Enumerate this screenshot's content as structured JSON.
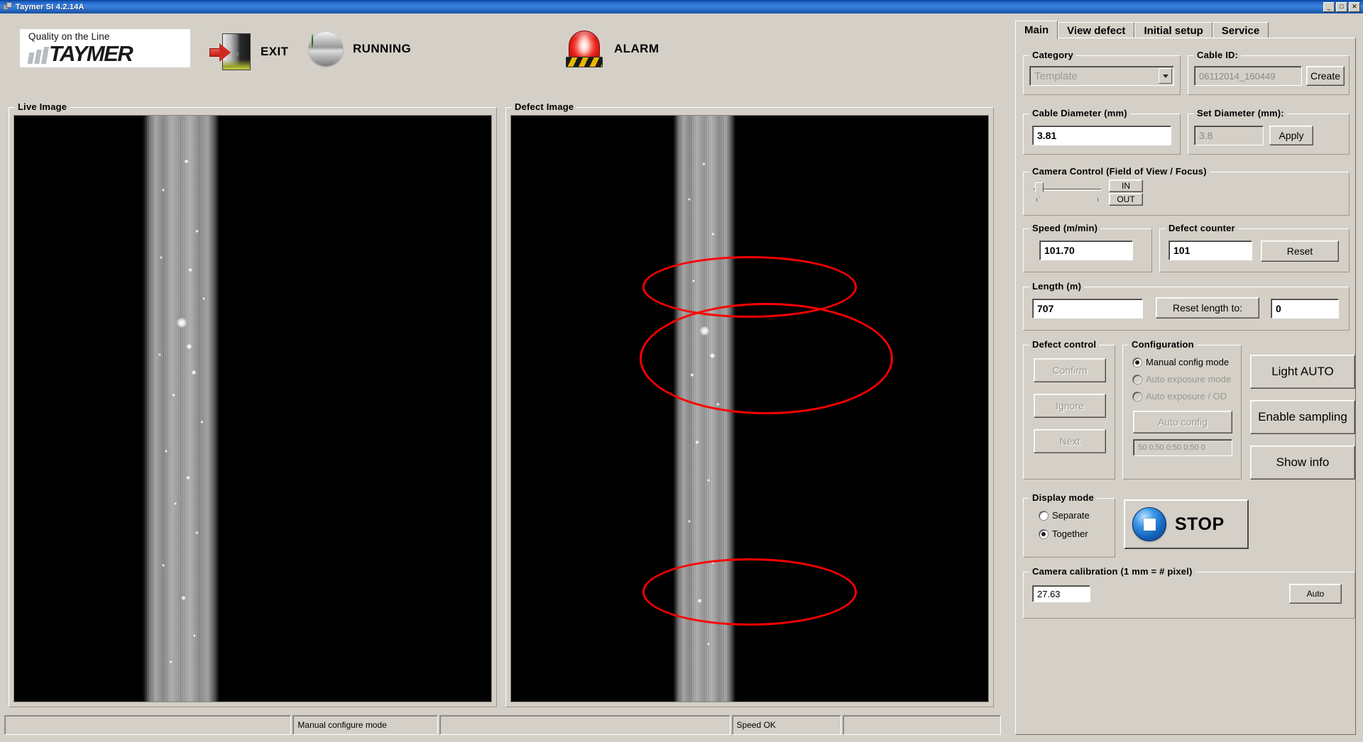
{
  "window": {
    "title": "Taymer SI 4.2.14A",
    "minimize": "_",
    "maximize": "□",
    "close": "✕"
  },
  "header": {
    "logo_tagline": "Quality on the Line",
    "logo_word": "TAYMER",
    "exit_label": "EXIT",
    "running_label": "RUNNING",
    "alarm_label": "ALARM"
  },
  "panels": {
    "live_image_title": "Live Image",
    "defect_image_title": "Defect Image"
  },
  "tabs": [
    {
      "label": "Main",
      "active": true
    },
    {
      "label": "View defect",
      "active": false
    },
    {
      "label": "Initial setup",
      "active": false
    },
    {
      "label": "Service",
      "active": false
    }
  ],
  "category": {
    "title": "Category",
    "selected": "Template"
  },
  "cable_id": {
    "title": "Cable ID:",
    "value": "06112014_160449",
    "create_label": "Create"
  },
  "cable_diameter": {
    "title": "Cable Diameter (mm)",
    "value": "3.81"
  },
  "set_diameter": {
    "title": "Set Diameter (mm):",
    "value": "3.8",
    "apply_label": "Apply"
  },
  "camera_control": {
    "title": "Camera Control (Field of View / Focus)",
    "in_label": "IN",
    "out_label": "OUT"
  },
  "speed": {
    "title": "Speed (m/min)",
    "value": "101.70"
  },
  "defect_counter": {
    "title": "Defect counter",
    "value": "101",
    "reset_label": "Reset"
  },
  "length": {
    "title": "Length (m)",
    "value": "707",
    "reset_length_label": "Reset length to:",
    "reset_value": "0"
  },
  "defect_control": {
    "title": "Defect control",
    "confirm_label": "Confirm",
    "ignore_label": "Ignore",
    "next_label": "Next"
  },
  "configuration": {
    "title": "Configuration",
    "options": [
      {
        "label": "Manual config mode",
        "selected": true,
        "disabled": false
      },
      {
        "label": "Auto exposure mode",
        "selected": false,
        "disabled": true
      },
      {
        "label": "Auto exposure / OD",
        "selected": false,
        "disabled": true
      }
    ],
    "auto_config_label": "Auto config",
    "values_field": "50 0;50 0;50 0;50 0"
  },
  "side_buttons": {
    "light_auto": "Light AUTO",
    "enable_sampling": "Enable sampling",
    "show_info": "Show info"
  },
  "display_mode": {
    "title": "Display mode",
    "options": [
      {
        "label": "Separate",
        "selected": false
      },
      {
        "label": "Together",
        "selected": true
      }
    ]
  },
  "stop": {
    "label": "STOP"
  },
  "camera_calibration": {
    "title": "Camera calibration (1 mm = # pixel)",
    "value": "27.63",
    "auto_label": "Auto"
  },
  "statusbar": {
    "cells": [
      "",
      "Manual configure mode",
      "",
      "Speed OK",
      ""
    ]
  },
  "colors": {
    "face": "#d4d0c8",
    "accent_orange": "#f0921e",
    "defect_marker": "#ff0000",
    "running_green": "#43b516",
    "alarm_red": "#e8201a",
    "stop_blue": "#1565c0"
  }
}
